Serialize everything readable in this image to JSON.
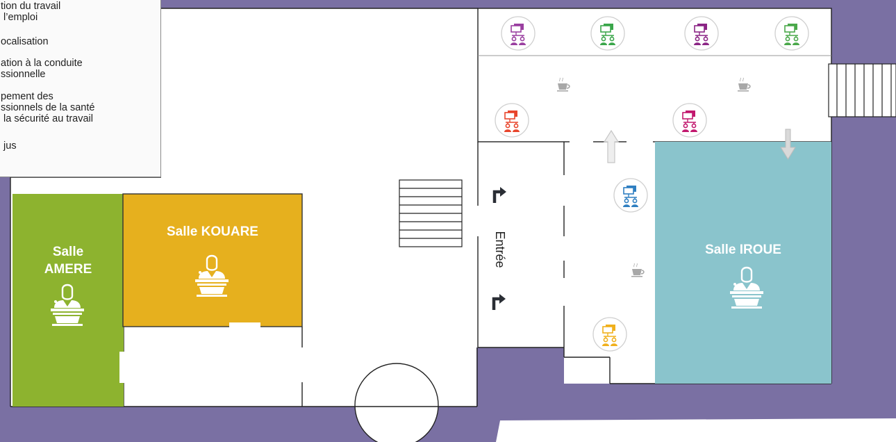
{
  "legend": {
    "items": [
      "tion du travail\n l’emploi",
      "ocalisation",
      "ation à la conduite\nssionnelle",
      "pement des\nssionnels de la santé\n la sécurité au travail",
      " jus"
    ]
  },
  "rooms": {
    "amere": "Salle\nAMERE",
    "kouare": "Salle KOUARE",
    "iroue": "Salle IROUE"
  },
  "entrance": {
    "label": "Entrée"
  },
  "colors": {
    "background": "#7a70a3",
    "amere": "#8db32f",
    "kouare": "#e6b01e",
    "iroue": "#8ac4cc",
    "floor": "#ffffff"
  },
  "stations": [
    {
      "icon": "workshop-icon",
      "color": "#9a3fa0"
    },
    {
      "icon": "workshop-icon",
      "color": "#3aa64a"
    },
    {
      "icon": "workshop-icon",
      "color": "#8b2585"
    },
    {
      "icon": "workshop-icon",
      "color": "#4aa84a"
    },
    {
      "icon": "workshop-icon",
      "color": "#e8452c"
    },
    {
      "icon": "workshop-icon",
      "color": "#c2186e"
    },
    {
      "icon": "workshop-icon",
      "color": "#2f7fc1"
    },
    {
      "icon": "workshop-icon",
      "color": "#f0b01c"
    }
  ],
  "coffee_points": [
    {
      "icon": "coffee-icon"
    },
    {
      "icon": "coffee-icon"
    },
    {
      "icon": "coffee-icon"
    }
  ]
}
